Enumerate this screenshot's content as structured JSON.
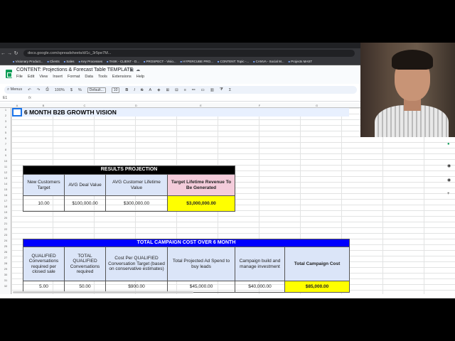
{
  "browser": {
    "url": "docs.google.com/spreadsheets/d/1c_3r5pe7M...",
    "bookmarks": [
      "Visionary Product...",
      "Clients",
      "Sales",
      "Key Processes",
      "TASK - CLIENT - D...",
      "PROSPECT - Visio...",
      "HYPERCUBE PRO...",
      "CONTENT: Topic -...",
      "CANVA - Social M...",
      "Projects MAST"
    ]
  },
  "doc": {
    "title": "CONTENT: Projections & Forecast Table TEMPLATE",
    "menus": [
      "File",
      "Edit",
      "View",
      "Insert",
      "Format",
      "Data",
      "Tools",
      "Extensions",
      "Help"
    ]
  },
  "toolbar": {
    "menus_label": "Menus",
    "zoom": "100%",
    "font": "Default...",
    "font_size": "10"
  },
  "formula": {
    "namebox": "E1",
    "fx": "fx"
  },
  "columns": [
    "A",
    "B",
    "C",
    "D",
    "E",
    "F",
    "G"
  ],
  "sheet": {
    "heading": "6 MONTH B2B GROWTH VISION",
    "results": {
      "banner": "RESULTS PROJECTION",
      "headers": [
        "New Customers Target",
        "AVG Deal Value",
        "AVG Customer Lifetime Value",
        "Target Lifetime Revenue To Be Generated"
      ],
      "values": [
        "10.00",
        "$100,000.00",
        "$300,000.00",
        "$3,000,000.00"
      ]
    },
    "cost": {
      "banner": "TOTAL CAMPAIGN COST OVER 6 MONTH",
      "headers": [
        "QUALIFIED Conversations required per closed sale",
        "TOTAL QUALIFIED Conversations required",
        "Cost Per QUALIFIED Conversation Target (based on conservative estimates)",
        "Total Projected Ad Spend to buy leads",
        "Campaign build and manage investment",
        "Total Campaign Cost"
      ],
      "values": [
        "5.00",
        "50.00",
        "$900.00",
        "$45,000.00",
        "$40,000.00",
        "$85,000.00"
      ]
    }
  }
}
